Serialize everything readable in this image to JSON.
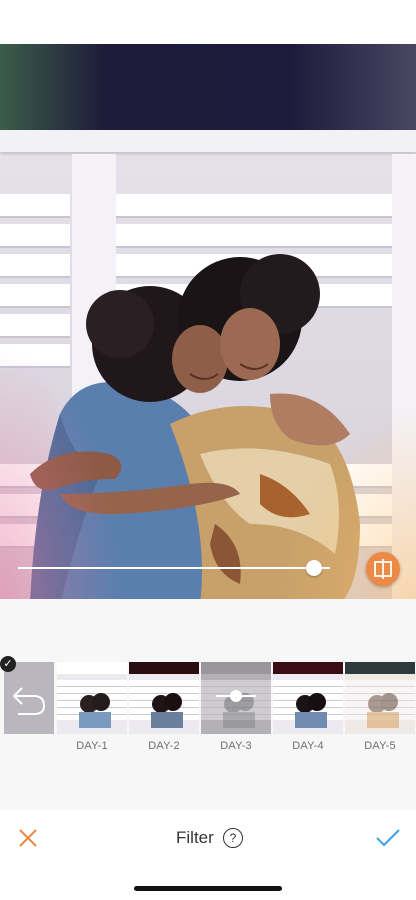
{
  "editor": {
    "intensity": 0.95
  },
  "filters": [
    {
      "label": "DAY-1",
      "tint": "#ffffff"
    },
    {
      "label": "DAY-2",
      "tint": "#2b0c13"
    },
    {
      "label": "DAY-3",
      "tint": "#9a979c"
    },
    {
      "label": "DAY-4",
      "tint": "#3a0c14"
    },
    {
      "label": "DAY-5",
      "tint": "#2c3a3c"
    }
  ],
  "selected_filter": "DAY-3",
  "bottom_bar": {
    "title": "Filter",
    "help": "?"
  },
  "icons": {
    "cancel": "close-icon",
    "confirm": "checkmark-icon",
    "compare": "compare-icon",
    "undo": "undo-icon",
    "adjust": "slider-adjust-icon",
    "selected": "check-badge-icon"
  },
  "colors": {
    "accent_orange": "#ec8a45",
    "confirm_blue": "#3aa0e8"
  }
}
